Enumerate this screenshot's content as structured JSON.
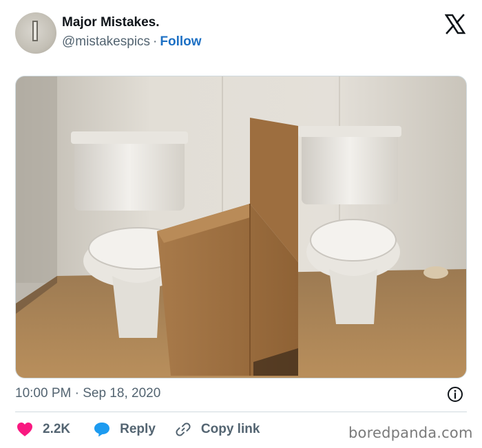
{
  "tweet": {
    "display_name": "Major Mistakes.",
    "handle": "@mistakespics",
    "separator": "·",
    "follow_label": "Follow",
    "time": "10:00 PM",
    "date_separator": "·",
    "date": "Sep 18, 2020",
    "media_icon": "photo-two-toilets-cardboard-divider"
  },
  "actions": {
    "like_count": "2.2K",
    "reply_label": "Reply",
    "copy_link_label": "Copy link"
  },
  "watermark": "boredpanda.com",
  "colors": {
    "accent": "#1d9bf0",
    "follow": "#1d70c4",
    "like": "#f91880",
    "muted": "#536471"
  }
}
